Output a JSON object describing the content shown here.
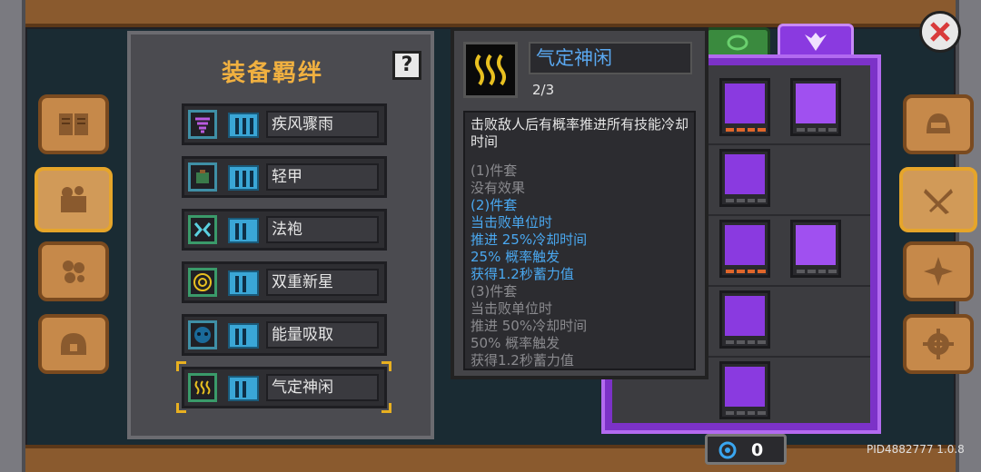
{
  "set_panel": {
    "title": "装备羁绊",
    "help_label": "?",
    "items": [
      {
        "name": "疾风骤雨",
        "icon": "whirlwind-icon"
      },
      {
        "name": "轻甲",
        "icon": "light-armor-icon"
      },
      {
        "name": "法袍",
        "icon": "robe-icon"
      },
      {
        "name": "双重新星",
        "icon": "double-nova-icon"
      },
      {
        "name": "能量吸取",
        "icon": "energy-drain-icon"
      },
      {
        "name": "气定神闲",
        "icon": "calm-steam-icon"
      }
    ]
  },
  "tooltip": {
    "name": "气定神闲",
    "count": "2/3",
    "description": "击败敌人后有概率推进所有技能冷却时间",
    "lines": [
      {
        "text": "(1)件套",
        "color": "grey"
      },
      {
        "text": "没有效果",
        "color": "grey"
      },
      {
        "text": "(2)件套",
        "color": "blue"
      },
      {
        "text": "当击败单位时",
        "color": "blue"
      },
      {
        "text": "推进 25%冷却时间",
        "color": "blue"
      },
      {
        "text": "25% 概率触发",
        "color": "blue"
      },
      {
        "text": "获得1.2秒蓄力值",
        "color": "blue"
      },
      {
        "text": "(3)件套",
        "color": "grey"
      },
      {
        "text": "当击败单位时",
        "color": "grey"
      },
      {
        "text": "推进 50%冷却时间",
        "color": "grey"
      },
      {
        "text": "50% 概率触发",
        "color": "grey"
      },
      {
        "text": "获得1.2秒蓄力值",
        "color": "grey"
      }
    ]
  },
  "counter": {
    "value": "0"
  },
  "version": "PID4882777 1.0.8",
  "colors": {
    "accent_gold": "#f0b040",
    "skill_purple": "#8a3ae0",
    "blue_text": "#4aa8f0"
  }
}
